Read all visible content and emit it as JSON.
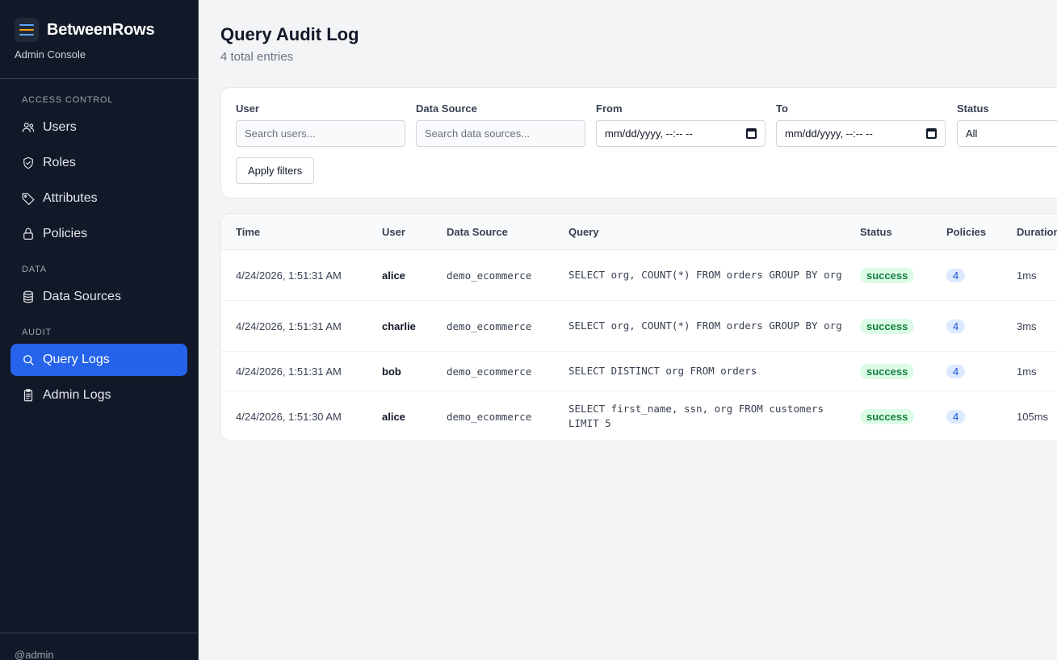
{
  "sidebar": {
    "brand": "BetweenRows",
    "subtitle": "Admin Console",
    "sections": [
      {
        "title": "ACCESS CONTROL",
        "items": [
          {
            "label": "Users",
            "icon": "users-icon"
          },
          {
            "label": "Roles",
            "icon": "shield-icon"
          },
          {
            "label": "Attributes",
            "icon": "tag-icon"
          },
          {
            "label": "Policies",
            "icon": "lock-icon"
          }
        ]
      },
      {
        "title": "DATA",
        "items": [
          {
            "label": "Data Sources",
            "icon": "database-icon"
          }
        ]
      },
      {
        "title": "AUDIT",
        "items": [
          {
            "label": "Query Logs",
            "icon": "search-icon",
            "active": true
          },
          {
            "label": "Admin Logs",
            "icon": "clipboard-icon"
          }
        ]
      }
    ],
    "footer": "@admin"
  },
  "page": {
    "title": "Query Audit Log",
    "subtitle": "4 total entries"
  },
  "filters": {
    "user": {
      "label": "User",
      "placeholder": "Search users..."
    },
    "data_source": {
      "label": "Data Source",
      "placeholder": "Search data sources..."
    },
    "from": {
      "label": "From",
      "value": "mm/dd/yyyy, --:-- --"
    },
    "to": {
      "label": "To",
      "value": "mm/dd/yyyy, --:-- --"
    },
    "status": {
      "label": "Status",
      "value": "All"
    },
    "apply_label": "Apply filters"
  },
  "table": {
    "columns": [
      "Time",
      "User",
      "Data Source",
      "Query",
      "Status",
      "Policies",
      "Duration"
    ],
    "rows": [
      {
        "time": "4/24/2026, 1:51:31 AM",
        "user": "alice",
        "data_source": "demo_ecommerce",
        "query": "SELECT org, COUNT(*) FROM orders GROUP BY org",
        "status": "success",
        "policies": "4",
        "duration": "1ms"
      },
      {
        "time": "4/24/2026, 1:51:31 AM",
        "user": "charlie",
        "data_source": "demo_ecommerce",
        "query": "SELECT org, COUNT(*) FROM orders GROUP BY org",
        "status": "success",
        "policies": "4",
        "duration": "3ms"
      },
      {
        "time": "4/24/2026, 1:51:31 AM",
        "user": "bob",
        "data_source": "demo_ecommerce",
        "query": "SELECT DISTINCT org FROM orders",
        "status": "success",
        "policies": "4",
        "duration": "1ms"
      },
      {
        "time": "4/24/2026, 1:51:30 AM",
        "user": "alice",
        "data_source": "demo_ecommerce",
        "query": "SELECT first_name, ssn, org FROM customers LIMIT 5",
        "status": "success",
        "policies": "4",
        "duration": "105ms"
      }
    ]
  },
  "colors": {
    "sidebar_bg": "#111827",
    "accent": "#2563eb",
    "success_bg": "#dcfce7",
    "success_text": "#15803d",
    "logo_line_top": "#60a5fa",
    "logo_line_mid": "#f59e0b",
    "logo_line_bottom": "#60a5fa"
  }
}
